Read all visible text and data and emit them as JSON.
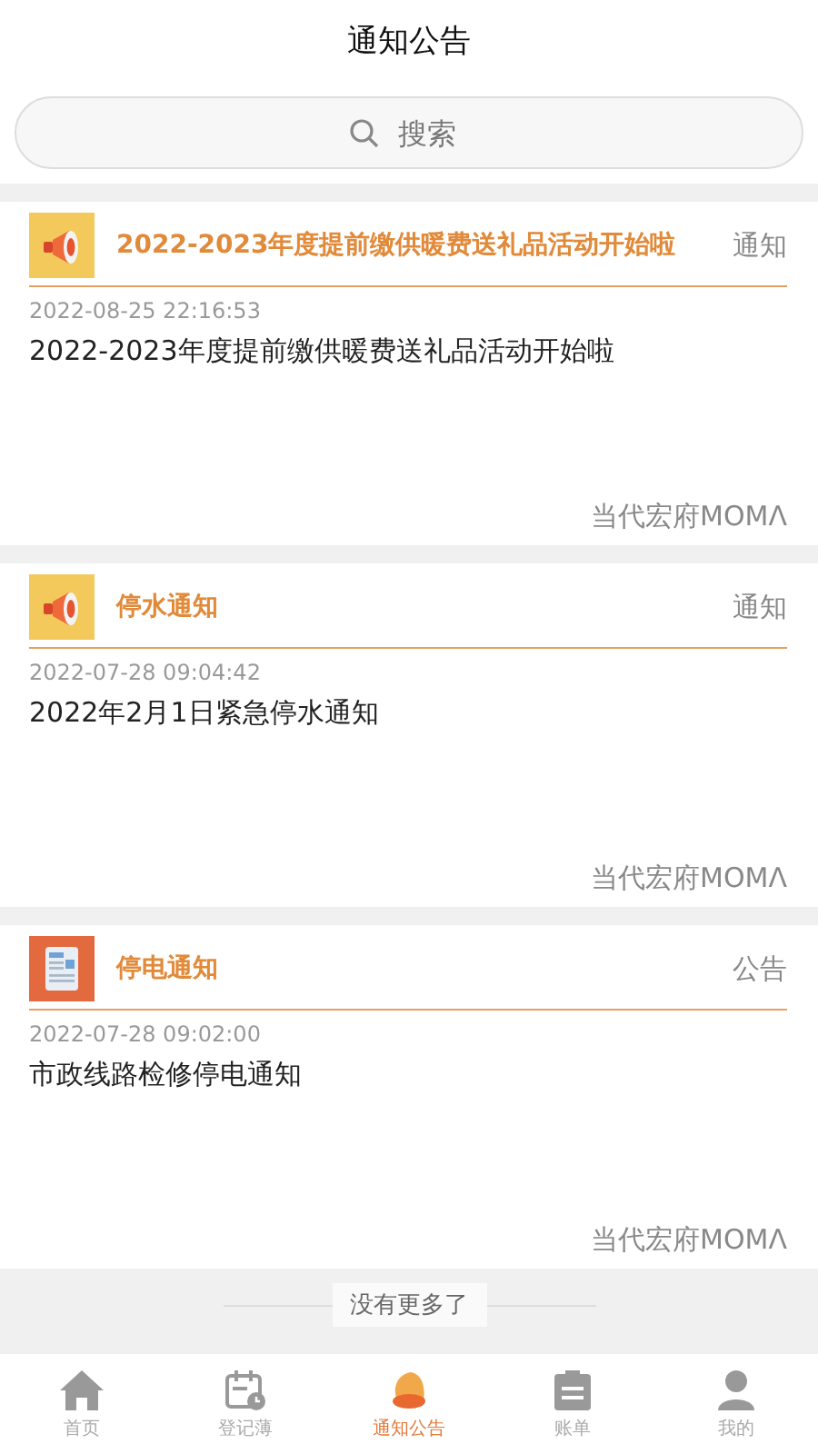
{
  "header": {
    "title": "通知公告"
  },
  "search": {
    "placeholder": "搜索"
  },
  "notices": [
    {
      "kind": "megaphone",
      "title": "2022-2023年度提前缴供暖费送礼品活动开始啦",
      "category": "通知",
      "time": "2022-08-25 22:16:53",
      "body": "2022-2023年度提前缴供暖费送礼品活动开始啦",
      "source": "当代宏府MOMΛ"
    },
    {
      "kind": "megaphone",
      "title": "停水通知",
      "category": "通知",
      "time": "2022-07-28 09:04:42",
      "body": "2022年2月1日紧急停水通知",
      "source": "当代宏府MOMΛ"
    },
    {
      "kind": "news",
      "title": "停电通知",
      "category": "公告",
      "time": "2022-07-28 09:02:00",
      "body": "市政线路检修停电通知",
      "source": "当代宏府MOMΛ"
    }
  ],
  "end_text": "没有更多了",
  "tabs": [
    {
      "kind": "home",
      "label": "首页",
      "selected": false
    },
    {
      "kind": "register",
      "label": "登记薄",
      "selected": false
    },
    {
      "kind": "bell",
      "label": "通知公告",
      "selected": true
    },
    {
      "kind": "bill",
      "label": "账单",
      "selected": false
    },
    {
      "kind": "user",
      "label": "我的",
      "selected": false
    }
  ]
}
